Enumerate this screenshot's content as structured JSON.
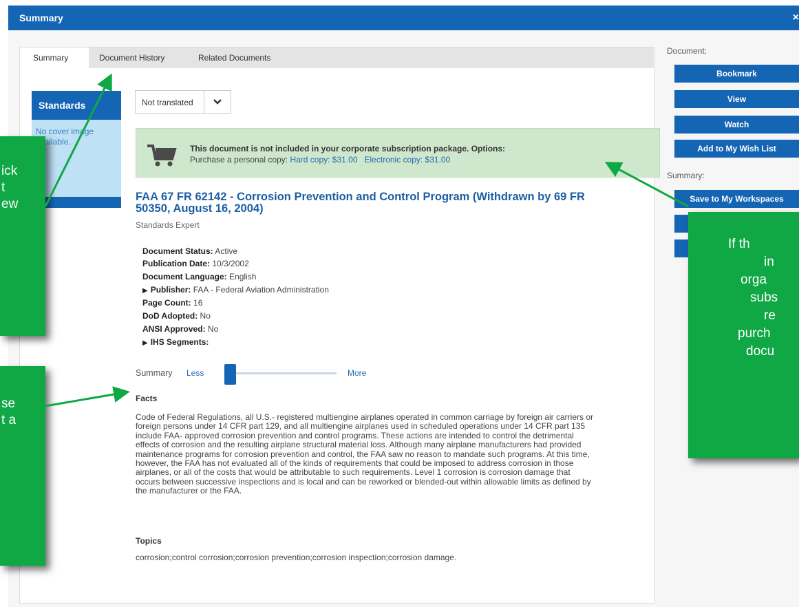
{
  "window": {
    "title": "Summary",
    "close": "×"
  },
  "tabs": [
    "Summary",
    "Document History",
    "Related Documents"
  ],
  "cover": {
    "heading": "Standards",
    "no_image": "No cover image available."
  },
  "translation_select": {
    "value": "Not translated"
  },
  "notice": {
    "headline": "This document is not included in your corporate subscription package. Options:",
    "purchase_prefix": "Purchase a personal copy:",
    "hard_copy": "Hard copy: $31.00",
    "electronic_copy": "Electronic copy: $31.00"
  },
  "document": {
    "title": "FAA 67 FR 62142 - Corrosion Prevention and Control Program (Withdrawn by 69 FR 50350, August 16, 2004)",
    "subtitle": "Standards Expert",
    "fields": [
      {
        "label": "Document Status:",
        "value": "Active"
      },
      {
        "label": "Publication Date:",
        "value": "10/3/2002"
      },
      {
        "label": "Document Language:",
        "value": "English"
      },
      {
        "label": "Publisher:",
        "value": "FAA - Federal Aviation Administration"
      },
      {
        "label": "Page Count:",
        "value": "16"
      },
      {
        "label": "DoD Adopted:",
        "value": "No"
      },
      {
        "label": "ANSI Approved:",
        "value": "No"
      },
      {
        "label": "IHS Segments:",
        "value": ""
      }
    ]
  },
  "summary_slider": {
    "label": "Summary",
    "less": "Less",
    "more": "More",
    "level": 0
  },
  "facts": {
    "heading": "Facts",
    "text": "Code of Federal Regulations, all U.S.- registered multiengine airplanes operated in common carriage by foreign air carriers or foreign persons under 14 CFR part 129, and all multiengine airplanes used in scheduled operations under 14 CFR part 135 include FAA- approved corrosion prevention and control programs. These actions are intended to control the detrimental effects of corrosion and the resulting airplane structural material loss. Although many airplane manufacturers had provided maintenance programs for corrosion prevention and control, the FAA saw no reason to mandate such programs. At this time, however, the FAA has not evaluated all of the kinds of requirements that could be imposed to address corrosion in those airplanes, or all of the costs that would be attributable to such requirements. Level 1 corrosion is corrosion damage that occurs between successive inspections and is local and can be reworked or blended-out within allowable limits as defined by the manufacturer or the FAA."
  },
  "topics": {
    "heading": "Topics",
    "text": "corrosion;control corrosion;corrosion prevention;corrosion inspection;corrosion damage."
  },
  "sidebar": {
    "document_label": "Document:",
    "summary_label": "Summary:",
    "buttons": [
      "Bookmark",
      "View",
      "Watch",
      "Add to My Wish List",
      "Save to My Workspaces",
      "",
      ""
    ]
  },
  "callouts": {
    "left_top": [
      "ick",
      "t",
      "ew"
    ],
    "left_bottom": [
      "se",
      "t a"
    ],
    "right": [
      "If th",
      "in",
      "orga",
      "subs",
      "re",
      "purch",
      "docu"
    ]
  },
  "colors": {
    "brand_blue": "#1565b5",
    "link_blue": "#1f68b3",
    "notice_green": "#cfe7cc",
    "callout_green": "#0fa844"
  }
}
